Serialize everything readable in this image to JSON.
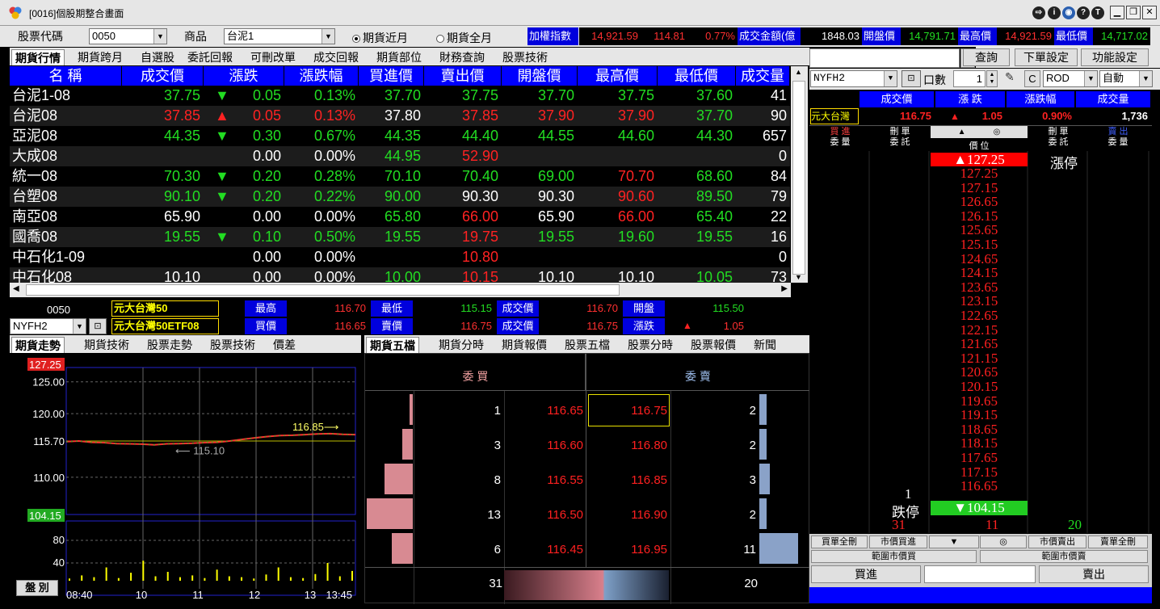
{
  "window": {
    "title": "[0016]個股期整合畫面",
    "icons": [
      "export-icon",
      "info-icon",
      "globe-icon",
      "help-icon",
      "text-icon"
    ],
    "controls": [
      "minimize",
      "restore",
      "close"
    ]
  },
  "toolbar": {
    "stock_code_label": "股票代碼",
    "stock_code_value": "0050",
    "product_label": "商品",
    "product_value": "台泥1",
    "radio_near": "期貨近月",
    "radio_all": "期貨全月",
    "index": {
      "weighted_label": "加權指數",
      "weighted_value": "14,921.59",
      "change": "114.81",
      "change_pct": "0.77%",
      "turnover_label": "成交金額(億",
      "turnover_value": "1848.03",
      "open_label": "開盤價",
      "open_value": "14,791.71",
      "high_label": "最高價",
      "high_value": "14,921.59",
      "low_label": "最低價",
      "low_value": "14,717.02"
    }
  },
  "top_tabs": [
    "期貨行情",
    "期貨跨月",
    "自選股",
    "委託回報",
    "可刪改單",
    "成交回報",
    "期貨部位",
    "財務查詢",
    "股票技術"
  ],
  "quote_table": {
    "headers": [
      "名 稱",
      "成交價",
      "漲跌",
      "漲跌幅",
      "買進價",
      "賣出價",
      "開盤價",
      "最高價",
      "最低價",
      "成交量"
    ],
    "rows": [
      {
        "name": "台泥1-08",
        "price": "37.75",
        "dir": "down",
        "chg": "0.05",
        "pct": "0.13%",
        "bid": "37.70",
        "ask": "37.75",
        "open": "37.70",
        "high": "37.75",
        "low": "37.60",
        "vol": "41",
        "colors": [
          "g",
          "g",
          "g",
          "g",
          "g",
          "g",
          "g",
          "g"
        ]
      },
      {
        "name": "台泥08",
        "price": "37.85",
        "dir": "up",
        "chg": "0.05",
        "pct": "0.13%",
        "bid": "37.80",
        "ask": "37.85",
        "open": "37.90",
        "high": "37.90",
        "low": "37.70",
        "vol": "90",
        "colors": [
          "r",
          "r",
          "r",
          "w",
          "r",
          "r",
          "r",
          "g"
        ]
      },
      {
        "name": "亞泥08",
        "price": "44.35",
        "dir": "down",
        "chg": "0.30",
        "pct": "0.67%",
        "bid": "44.35",
        "ask": "44.40",
        "open": "44.55",
        "high": "44.60",
        "low": "44.30",
        "vol": "657",
        "colors": [
          "g",
          "g",
          "g",
          "g",
          "g",
          "g",
          "g",
          "g"
        ]
      },
      {
        "name": "大成08",
        "price": "",
        "dir": "",
        "chg": "0.00",
        "pct": "0.00%",
        "bid": "44.95",
        "ask": "52.90",
        "open": "",
        "high": "",
        "low": "",
        "vol": "0",
        "colors": [
          "w",
          "w",
          "w",
          "g",
          "r",
          "w",
          "w",
          "w"
        ]
      },
      {
        "name": "統一08",
        "price": "70.30",
        "dir": "down",
        "chg": "0.20",
        "pct": "0.28%",
        "bid": "70.10",
        "ask": "70.40",
        "open": "69.00",
        "high": "70.70",
        "low": "68.60",
        "vol": "84",
        "colors": [
          "g",
          "g",
          "g",
          "g",
          "g",
          "g",
          "r",
          "g"
        ]
      },
      {
        "name": "台塑08",
        "price": "90.10",
        "dir": "down",
        "chg": "0.20",
        "pct": "0.22%",
        "bid": "90.00",
        "ask": "90.30",
        "open": "90.30",
        "high": "90.60",
        "low": "89.50",
        "vol": "79",
        "colors": [
          "g",
          "g",
          "g",
          "g",
          "w",
          "w",
          "r",
          "g"
        ]
      },
      {
        "name": "南亞08",
        "price": "65.90",
        "dir": "",
        "chg": "0.00",
        "pct": "0.00%",
        "bid": "65.80",
        "ask": "66.00",
        "open": "65.90",
        "high": "66.00",
        "low": "65.40",
        "vol": "22",
        "colors": [
          "w",
          "w",
          "w",
          "g",
          "r",
          "w",
          "r",
          "g"
        ]
      },
      {
        "name": "國喬08",
        "price": "19.55",
        "dir": "down",
        "chg": "0.10",
        "pct": "0.50%",
        "bid": "19.55",
        "ask": "19.75",
        "open": "19.55",
        "high": "19.60",
        "low": "19.55",
        "vol": "16",
        "colors": [
          "g",
          "g",
          "g",
          "g",
          "r",
          "g",
          "g",
          "g"
        ]
      },
      {
        "name": "中石化1-09",
        "price": "",
        "dir": "",
        "chg": "0.00",
        "pct": "0.00%",
        "bid": "",
        "ask": "10.80",
        "open": "",
        "high": "",
        "low": "",
        "vol": "0",
        "colors": [
          "w",
          "w",
          "w",
          "w",
          "r",
          "w",
          "w",
          "w"
        ]
      },
      {
        "name": "中石化08",
        "price": "10.10",
        "dir": "",
        "chg": "0.00",
        "pct": "0.00%",
        "bid": "10.00",
        "ask": "10.15",
        "open": "10.10",
        "high": "10.10",
        "low": "10.05",
        "vol": "73",
        "colors": [
          "w",
          "w",
          "w",
          "g",
          "r",
          "w",
          "w",
          "g"
        ]
      }
    ]
  },
  "mid_info": {
    "code": "0050",
    "stock_name": "元大台灣50",
    "contract": "NYFH2",
    "contract_name": "元大台灣50ETF08",
    "high_label": "最高",
    "high": "116.70",
    "bid_label": "買價",
    "bid": "116.65",
    "low_label": "最低",
    "low": "115.15",
    "ask_label": "賣價",
    "ask": "116.75",
    "deal_label": "成交價",
    "deal": "116.70",
    "deal2_label": "成交價",
    "deal2": "116.75",
    "open_label": "開盤",
    "open": "115.50",
    "chg_label": "漲跌",
    "chg": "1.05"
  },
  "chart_tabs": [
    "期貨走勢",
    "期貨技術",
    "股票走勢",
    "股票技術",
    "價差"
  ],
  "book_tabs": [
    "期貨五檔",
    "期貨分時",
    "期貨報價",
    "股票五檔",
    "股票分時",
    "股票報價",
    "新聞"
  ],
  "chart_data": {
    "type": "line",
    "title": "",
    "x_ticks": [
      "08:40",
      "10",
      "11",
      "12",
      "13",
      "13:45"
    ],
    "price_ticks": [
      "125.00",
      "120.00",
      "115.70",
      "110.00"
    ],
    "limit_up": "127.25",
    "limit_down": "104.15",
    "vol_ticks": [
      "80",
      "40"
    ],
    "annot_high": "116.85",
    "annot_low": "115.10",
    "ylim": [
      104.15,
      127.25
    ],
    "ref_price": 115.7,
    "series": [
      {
        "values": [
          115.6,
          115.7,
          115.5,
          115.45,
          115.3,
          115.25,
          115.2,
          115.1,
          115.25,
          115.3,
          115.35,
          115.45,
          115.5,
          115.7,
          115.95,
          116.2,
          116.4,
          116.55,
          116.6,
          116.7,
          116.8,
          116.85,
          116.75,
          116.7
        ]
      }
    ],
    "volume": [
      5,
      12,
      8,
      30,
      6,
      18,
      45,
      10,
      20,
      8,
      12,
      6,
      25,
      10,
      8,
      5,
      14,
      30,
      8,
      6,
      15,
      40,
      10,
      22
    ]
  },
  "book": {
    "bid_header": "委 買",
    "ask_header": "委 賣",
    "rows": [
      {
        "bid_qty": "1",
        "bid": "116.65",
        "ask": "116.75",
        "ask_qty": "2"
      },
      {
        "bid_qty": "3",
        "bid": "116.60",
        "ask": "116.80",
        "ask_qty": "2"
      },
      {
        "bid_qty": "8",
        "bid": "116.55",
        "ask": "116.85",
        "ask_qty": "3"
      },
      {
        "bid_qty": "13",
        "bid": "116.50",
        "ask": "116.90",
        "ask_qty": "2"
      },
      {
        "bid_qty": "6",
        "bid": "116.45",
        "ask": "116.95",
        "ask_qty": "11"
      }
    ],
    "bid_total": "31",
    "ask_total": "20",
    "bid_bar_values": [
      1,
      3,
      8,
      13,
      6
    ],
    "ask_bar_values": [
      2,
      2,
      3,
      2,
      11
    ],
    "bid_ratio": 0.61
  },
  "order_panel": {
    "query_btn": "查詢",
    "order_settings_btn": "下單設定",
    "function_settings_btn": "功能設定",
    "contract": "NYFH2",
    "qty_label": "口數",
    "qty": "1",
    "c_btn": "C",
    "order_type": "ROD",
    "mode": "自動",
    "info_headers": [
      "成交價",
      "漲 跌",
      "漲跌幅",
      "成交量"
    ],
    "info_name": "元大台灣",
    "info_price": "116.75",
    "info_chg": "1.05",
    "info_pct": "0.90%",
    "info_vol": "1,736"
  },
  "ladder": {
    "col_buy_a": "買 進",
    "col_buy_b": "委 量",
    "col_del_a": "刪 單",
    "col_del_b": "委 託",
    "col_price": "價 位",
    "col_del2_a": "刪 單",
    "col_del2_b": "委 託",
    "col_sell_a": "賣 出",
    "col_sell_b": "委 量",
    "limit_up_label": "漲停",
    "limit_down_label": "跌停",
    "prices": [
      "127.25",
      "127.25",
      "127.15",
      "126.65",
      "126.15",
      "125.65",
      "125.15",
      "124.65",
      "124.15",
      "123.65",
      "123.15",
      "122.65",
      "122.15",
      "121.65",
      "121.15",
      "120.65",
      "120.15",
      "119.65",
      "119.15",
      "118.65",
      "118.15",
      "117.65",
      "117.15",
      "116.65"
    ],
    "top_price": "127.25",
    "bottom_price": "104.15",
    "bid_qty_at_best": "1",
    "total_bid": "31",
    "total_mid": "11",
    "total_ask": "20",
    "btn_buy_del_all": "買單全刪",
    "btn_market_buy": "市價買進",
    "btn_down": "▼",
    "btn_center": "◎",
    "btn_market_sell": "市價賣出",
    "btn_sell_del_all": "賣單全刪",
    "btn_range_market_buy": "範圍市價買",
    "btn_range_market_sell": "範圍市價賣",
    "buy_btn": "買進",
    "sell_btn": "賣出"
  },
  "disk_btn": "盤 別"
}
